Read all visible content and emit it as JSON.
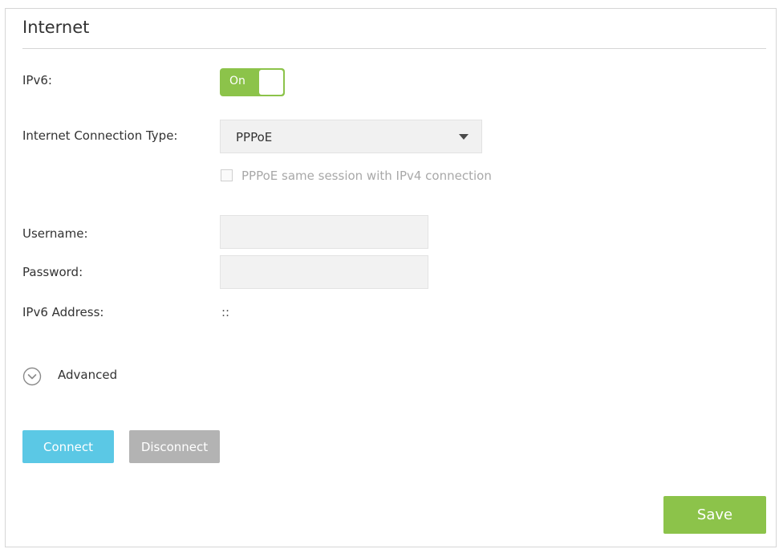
{
  "section": {
    "title": "Internet"
  },
  "ipv6": {
    "label": "IPv6:",
    "toggle_text": "On"
  },
  "connection_type": {
    "label": "Internet Connection Type:",
    "selected": "PPPoE"
  },
  "same_session": {
    "label": "PPPoE same session with IPv4 connection",
    "checked": false
  },
  "username": {
    "label": "Username:",
    "value": ""
  },
  "password": {
    "label": "Password:",
    "value": ""
  },
  "ipv6_address": {
    "label": "IPv6 Address:",
    "value": "::"
  },
  "advanced": {
    "label": "Advanced",
    "icon": "chevron-circle-down-icon"
  },
  "buttons": {
    "connect": "Connect",
    "disconnect": "Disconnect",
    "save": "Save"
  },
  "colors": {
    "green_accent": "#8cc34a",
    "connect_blue": "#5bc8e5",
    "disabled_gray": "#b3b3b3"
  }
}
